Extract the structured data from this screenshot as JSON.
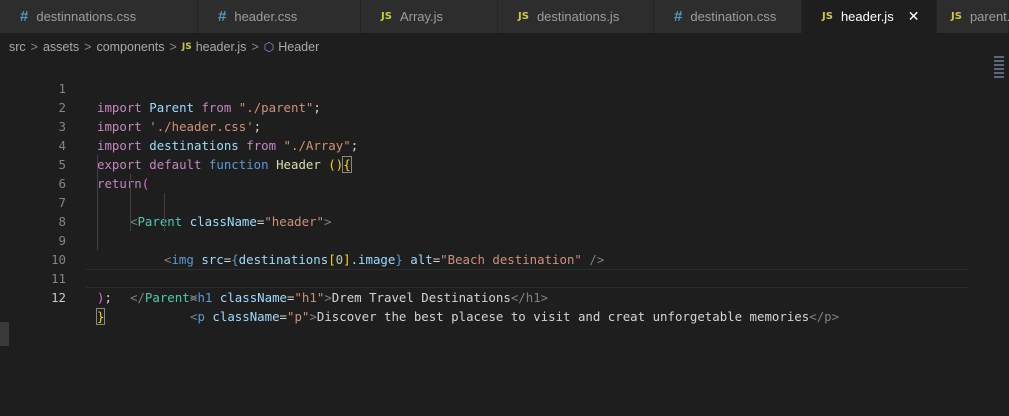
{
  "tabs": [
    {
      "label": "destinnations.css",
      "icon": "#",
      "type": "css",
      "active": false
    },
    {
      "label": "header.css",
      "icon": "#",
      "type": "css",
      "active": false
    },
    {
      "label": "Array.js",
      "icon": "JS",
      "type": "js",
      "active": false
    },
    {
      "label": "destinations.js",
      "icon": "JS",
      "type": "js",
      "active": false
    },
    {
      "label": "destination.css",
      "icon": "#",
      "type": "css",
      "active": false
    },
    {
      "label": "header.js",
      "icon": "JS",
      "type": "js",
      "active": true,
      "close": "✕"
    },
    {
      "label": "parent.js",
      "icon": "JS",
      "type": "js",
      "active": false
    }
  ],
  "breadcrumb": {
    "parts": [
      "src",
      "assets",
      "components"
    ],
    "file_icon": "JS",
    "file": "header.js",
    "symbol_icon": "⬡",
    "symbol": "Header",
    "separator": ">"
  },
  "editor": {
    "line_numbers": [
      "1",
      "2",
      "3",
      "4",
      "5",
      "6",
      "7",
      "8",
      "9",
      "10",
      "11",
      "12"
    ],
    "current_line": "12",
    "code": {
      "l1": {
        "kw_import": "import",
        "id_parent": "Parent",
        "kw_from": "from",
        "str": "\"./parent\"",
        "semi": ";"
      },
      "l2": {
        "kw_import": "import",
        "str": "'./header.css'",
        "semi": ";"
      },
      "l3": {
        "kw_import": "import",
        "id_dest": "destinations",
        "kw_from": "from",
        "str": "\"./Array\"",
        "semi": ";"
      },
      "l4": {
        "kw_export": "export",
        "kw_default": "default",
        "kw_function": "function",
        "fn": "Header",
        "parens": " ()",
        "brace": "{"
      },
      "l5": {
        "kw_return": "return",
        "paren": "("
      },
      "l6": {
        "open": "<",
        "tag": "Parent",
        "attr": "className",
        "eq": "=",
        "val": "\"header\"",
        "close": ">"
      },
      "l7": {
        "open": "<",
        "tag": "img",
        "attr_src": "src",
        "eq": "=",
        "b_open": "{",
        "expr_obj": "destinations",
        "sq_open": "[",
        "idx": "0",
        "sq_close": "]",
        "prop": ".image",
        "b_close": "}",
        "attr_alt": "alt",
        "alt_val": "\"Beach destination\"",
        "close": " />"
      },
      "l8": {
        "open": "<",
        "tag": "h1",
        "attr": "className",
        "eq": "=",
        "val": "\"h1\"",
        "gt": ">",
        "text": "Drem Travel Destinations",
        "end": "</h1>"
      },
      "l9": {
        "open": "<",
        "tag": "p",
        "attr": "className",
        "eq": "=",
        "val": "\"p\"",
        "gt": ">",
        "text": "Discover the best placese to visit and creat unforgetable memories",
        "end": "</p>"
      },
      "l10": {
        "end_open": "</",
        "tag": "Parent",
        "gt": ">"
      },
      "l11": {
        "paren": ")",
        "semi": ";"
      },
      "l12": {
        "brace": "}"
      }
    }
  },
  "colors": {
    "background": "#1e1e1e",
    "tabbar": "#252526",
    "keyword": "#c586c0",
    "storage": "#569cd6",
    "variable": "#9cdcfe",
    "string": "#ce9178",
    "component": "#4ec9b0",
    "function": "#dcdcaa",
    "css_icon": "#519aba",
    "js_icon": "#cbcb41"
  }
}
